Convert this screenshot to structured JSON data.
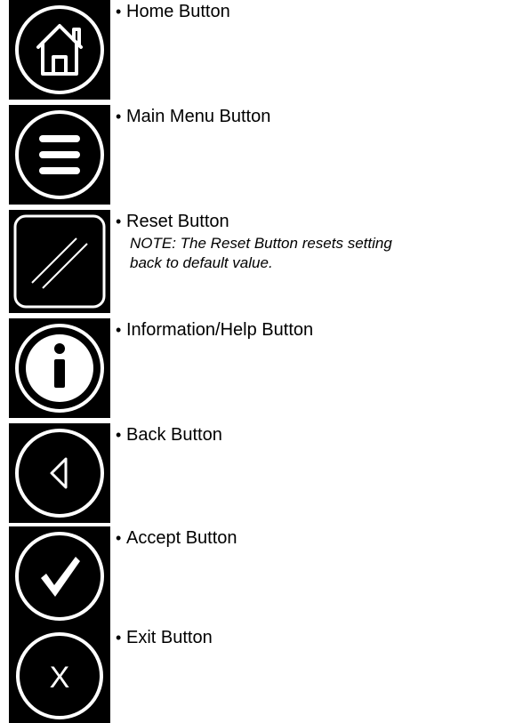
{
  "bullet_char": "•",
  "items": [
    {
      "icon": "home-icon",
      "label": "Home Button"
    },
    {
      "icon": "menu-icon",
      "label": "Main Menu Button"
    },
    {
      "icon": "reset-icon",
      "label": "Reset Button",
      "note_line1": "NOTE: The Reset Button resets setting",
      "note_line2": "back to default value."
    },
    {
      "icon": "info-icon",
      "label": "Information/Help Button"
    },
    {
      "icon": "back-icon",
      "label": "Back Button"
    },
    {
      "icon": "accept-icon",
      "label": "Accept Button"
    },
    {
      "icon": "exit-icon",
      "label": "Exit Button",
      "glyph": "X"
    }
  ],
  "colors": {
    "icon_background": "#000000",
    "icon_stroke": "#ffffff",
    "text": "#000000"
  }
}
